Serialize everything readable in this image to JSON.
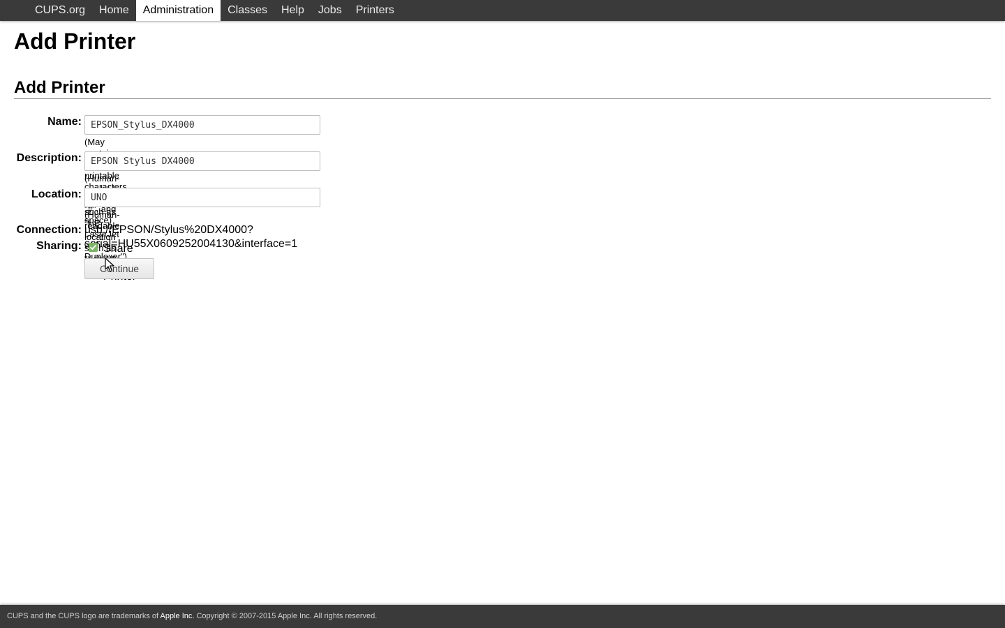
{
  "nav": {
    "items": [
      {
        "label": "CUPS.org",
        "active": false
      },
      {
        "label": "Home",
        "active": false
      },
      {
        "label": "Administration",
        "active": true
      },
      {
        "label": "Classes",
        "active": false
      },
      {
        "label": "Help",
        "active": false
      },
      {
        "label": "Jobs",
        "active": false
      },
      {
        "label": "Printers",
        "active": false
      }
    ]
  },
  "page": {
    "title": "Add Printer",
    "section_title": "Add Printer"
  },
  "form": {
    "name": {
      "label": "Name:",
      "value": "EPSON_Stylus_DX4000",
      "hint": "(May contain any printable characters except \"/\", \"#\", and space)"
    },
    "description": {
      "label": "Description:",
      "value": "EPSON Stylus DX4000",
      "hint": "(Human-readable description such as \"HP LaserJet with Duplexer\")"
    },
    "location": {
      "label": "Location:",
      "value": "UNO",
      "hint": "(Human-readable location such as \"Lab 1\")"
    },
    "connection": {
      "label": "Connection:",
      "value": "usb://EPSON/Stylus%20DX4000?serial=HU55X0609252004130&interface=1"
    },
    "sharing": {
      "label": "Sharing:",
      "checkbox_label": "Share This Printer",
      "checked": true
    },
    "continue_label": "Continue"
  },
  "footer": {
    "text_before": "CUPS and the CUPS logo are trademarks of ",
    "link": "Apple Inc.",
    "text_after": " Copyright © 2007-2015 Apple Inc. All rights reserved."
  },
  "colors": {
    "bar_background": "#3a3a3a",
    "checkbox_accent": "#7fb46a"
  },
  "icons": {
    "checkbox": "check-icon",
    "cursor": "mouse-pointer-icon"
  }
}
